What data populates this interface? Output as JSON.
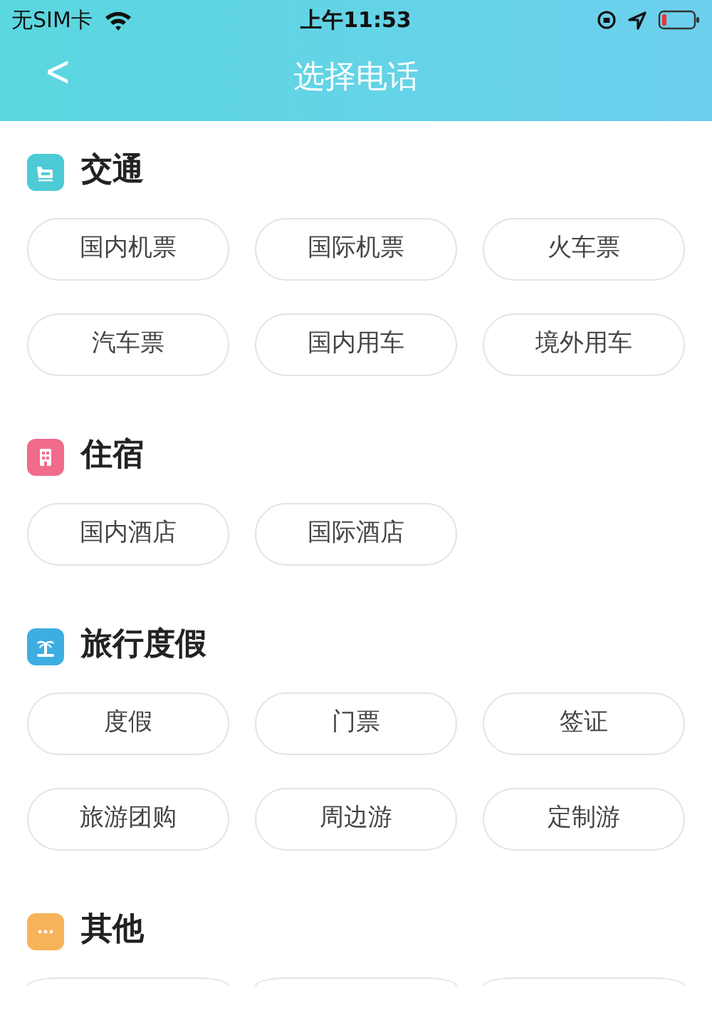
{
  "status_bar": {
    "carrier": "无SIM卡",
    "time": "上午11:53"
  },
  "nav": {
    "back": "<",
    "title": "选择电话"
  },
  "sections": [
    {
      "title": "交通",
      "color": "#4ccbd6",
      "options": [
        {
          "label": "国内机票"
        },
        {
          "label": "国际机票"
        },
        {
          "label": "火车票"
        },
        {
          "label": "汽车票"
        },
        {
          "label": "国内用车"
        },
        {
          "label": "境外用车"
        }
      ]
    },
    {
      "title": "住宿",
      "color": "#f06b8c",
      "options": [
        {
          "label": "国内酒店"
        },
        {
          "label": "国际酒店"
        }
      ]
    },
    {
      "title": "旅行度假",
      "color": "#3eaee2",
      "options": [
        {
          "label": "度假"
        },
        {
          "label": "门票"
        },
        {
          "label": "签证"
        },
        {
          "label": "旅游团购"
        },
        {
          "label": "周边游"
        },
        {
          "label": "定制游"
        }
      ]
    },
    {
      "title": "其他",
      "color": "#f7b35a",
      "options": [
        {
          "kind": "cut"
        },
        {
          "kind": "cut"
        },
        {
          "kind": "cut"
        }
      ]
    }
  ]
}
